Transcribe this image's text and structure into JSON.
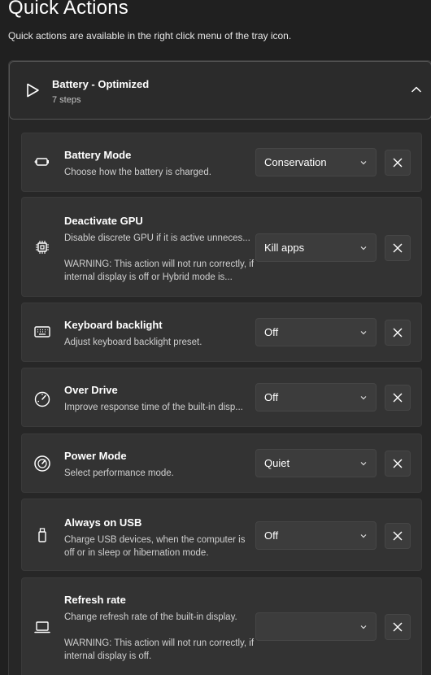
{
  "page": {
    "title": "Quick Actions",
    "subtitle": "Quick actions are available in the right click menu of the tray icon."
  },
  "group": {
    "name": "Battery - Optimized",
    "steps_label": "7 steps",
    "expanded": true
  },
  "steps": [
    {
      "icon": "battery-icon",
      "title": "Battery Mode",
      "description": "Choose how the battery is charged.",
      "value": "Conservation"
    },
    {
      "icon": "chip-icon",
      "title": "Deactivate GPU",
      "description": "Disable discrete GPU if it is active unneces...",
      "warning": "WARNING: This action will not run correctly, if internal display is off or Hybrid mode is...",
      "value": "Kill apps"
    },
    {
      "icon": "keyboard-icon",
      "title": "Keyboard backlight",
      "description": "Adjust keyboard backlight preset.",
      "value": "Off"
    },
    {
      "icon": "gauge-icon",
      "title": "Over Drive",
      "description": "Improve response time of the built-in disp...",
      "value": "Off"
    },
    {
      "icon": "speedometer-icon",
      "title": "Power Mode",
      "description": "Select performance mode.",
      "value": "Quiet"
    },
    {
      "icon": "usb-icon",
      "title": "Always on USB",
      "description": "Charge USB devices, when the computer is off or in sleep or hibernation mode.",
      "value": "Off"
    },
    {
      "icon": "laptop-icon",
      "title": "Refresh rate",
      "description": "Change refresh rate of the built-in display.",
      "warning": "WARNING: This action will not run correctly, if internal display is off.",
      "value": ""
    }
  ]
}
